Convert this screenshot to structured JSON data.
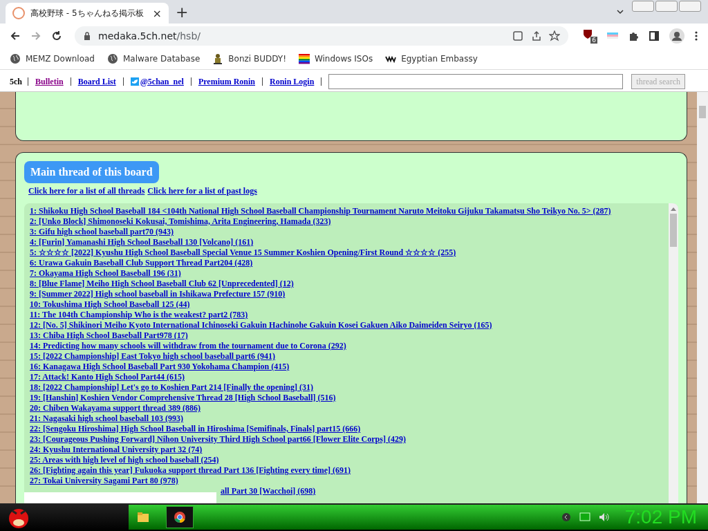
{
  "tab": {
    "title": "高校野球 - 5ちゃんねる掲示板",
    "close": "×",
    "new": "+"
  },
  "address": {
    "host": "medaka.5ch.net",
    "path": "/hsb/",
    "ext_badge": "6"
  },
  "bookmarks": [
    {
      "label": "MEMZ Download",
      "kind": "globe"
    },
    {
      "label": "Malware Database",
      "kind": "globe"
    },
    {
      "label": "Bonzi BUDDY!",
      "kind": "figure"
    },
    {
      "label": "Windows ISOs",
      "kind": "flag"
    },
    {
      "label": "Egyptian Embassy",
      "kind": "wix"
    }
  ],
  "nav": {
    "brand": "5ch",
    "links": [
      "Bulletin",
      "Board List",
      "@5chan_nel",
      "Premium Ronin",
      "Ronin Login"
    ],
    "search_button": "thread search"
  },
  "main": {
    "heading": "Main thread of this board",
    "links": [
      "Click here for a list of all threads",
      "Click here for a list of past logs"
    ],
    "threads": [
      "1: Shikoku High School Baseball 184 <104th National High School Baseball Championship Tournament Naruto Meitoku Gijuku Takamatsu Sho Teikyo No. 5> (287)",
      "2: [Unko Block] Shimonoseki Kokusai, Tomishima, Arita Engineering, Hamada (323)",
      "3: Gifu high school baseball part70 (943)",
      "4: [Furin] Yamanashi High School Baseball 130 [Volcano] (161)",
      "5: ☆☆☆☆ [2022] Kyushu High School Baseball Special Venue 15 Summer Koshien Opening/First Round ☆☆☆☆ (255)",
      "6: Urawa Gakuin Baseball Club Support Thread Part204 (428)",
      "7: Okayama High School Baseball 196 (31)",
      "8: [Blue Flame] Meiho High School Baseball Club 62 [Unprecedented] (12)",
      "9: [Summer 2022] High school baseball in Ishikawa Prefecture 157 (910)",
      "10: Tokushima High School Baseball 125 (44)",
      "11: The 104th Championship Who is the weakest? part2 (783)",
      "12: [No. 5] Shikinori Meiho Kyoto International Ichinoseki Gakuin Hachinohe Gakuin Kosei Gakuen Aiko Daimeiden Seiryo (165)",
      "13: Chiba High School Baseball Part978 (17)",
      "14: Predicting how many schools will withdraw from the tournament due to Corona (292)",
      "15: [2022 Championship] East Tokyo high school baseball part6 (941)",
      "16: Kanagawa High School Baseball Part 930 Yokohama Champion (415)",
      "17: Attack! Kanto High School Part44 (615)",
      "18: [2022 Championship] Let's go to Koshien Part 214 [Finally the opening] (31)",
      "19: [Hanshin] Koshien Vendor Comprehensive Thread 28 [High School Baseball] (516)",
      "20: Chiben Wakayama support thread 389 (886)",
      "21: Nagasaki high school baseball 103 (993)",
      "22: [Sengoku Hiroshima] High School Baseball in Hiroshima [Semifinals, Finals] part15 (666)",
      "23: [Courageous Pushing Forward] Nihon University Third High School part66 [Flower Elite Corps] (429)",
      "24: Kyushu International University part 32 (74)",
      "25: Areas with high level of high school baseball (254)",
      "26: [Fighting again this year] Fukuoka support thread Part 136 [Fighting every time] (691)",
      "27: Tokai University Sagami Part 80 (978)",
      "all Part 30 [Wacchoi] (698)"
    ]
  },
  "clock": "7:02 PM"
}
